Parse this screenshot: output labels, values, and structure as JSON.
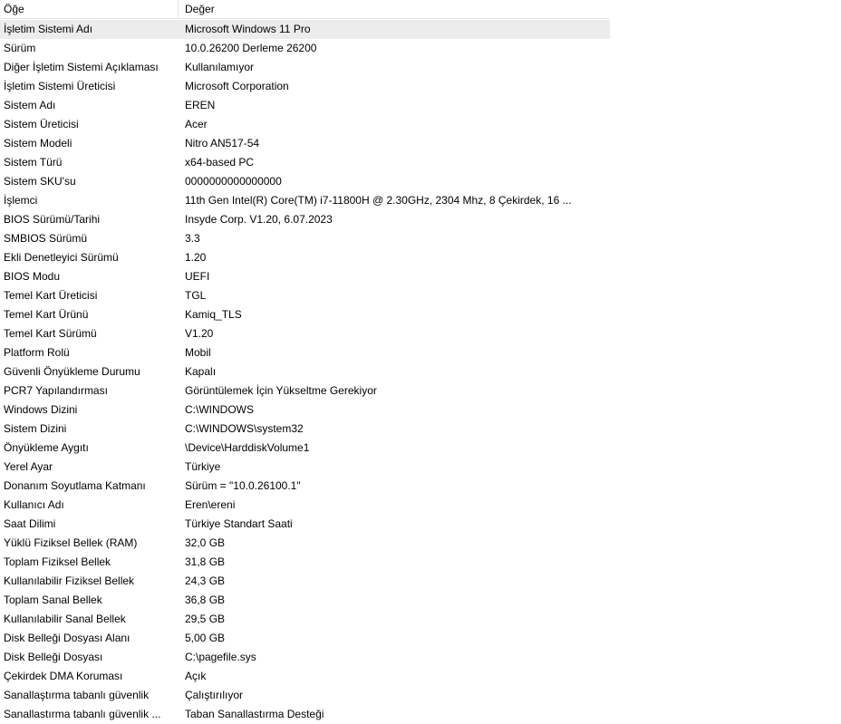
{
  "columns": {
    "item": "Öğe",
    "value": "Değer"
  },
  "rows": [
    {
      "item": "İşletim Sistemi Adı",
      "value": "Microsoft Windows 11 Pro"
    },
    {
      "item": "Sürüm",
      "value": "10.0.26200 Derleme 26200"
    },
    {
      "item": "Diğer İşletim Sistemi Açıklaması",
      "value": "Kullanılamıyor"
    },
    {
      "item": "İşletim Sistemi Üreticisi",
      "value": "Microsoft Corporation"
    },
    {
      "item": "Sistem Adı",
      "value": "EREN"
    },
    {
      "item": "Sistem Üreticisi",
      "value": "Acer"
    },
    {
      "item": "Sistem Modeli",
      "value": "Nitro AN517-54"
    },
    {
      "item": "Sistem Türü",
      "value": "x64-based PC"
    },
    {
      "item": "Sistem SKU'su",
      "value": "0000000000000000"
    },
    {
      "item": "İşlemci",
      "value": "11th Gen Intel(R) Core(TM) i7-11800H @ 2.30GHz, 2304 Mhz, 8 Çekirdek, 16 ..."
    },
    {
      "item": "BIOS Sürümü/Tarihi",
      "value": "Insyde Corp. V1.20, 6.07.2023"
    },
    {
      "item": "SMBIOS Sürümü",
      "value": "3.3"
    },
    {
      "item": "Ekli Denetleyici Sürümü",
      "value": "1.20"
    },
    {
      "item": "BIOS Modu",
      "value": "UEFI"
    },
    {
      "item": "Temel Kart Üreticisi",
      "value": "TGL"
    },
    {
      "item": "Temel Kart Ürünü",
      "value": "Kamiq_TLS"
    },
    {
      "item": "Temel Kart Sürümü",
      "value": "V1.20"
    },
    {
      "item": "Platform Rolü",
      "value": "Mobil"
    },
    {
      "item": "Güvenli Önyükleme Durumu",
      "value": "Kapalı"
    },
    {
      "item": "PCR7 Yapılandırması",
      "value": "Görüntülemek İçin Yükseltme Gerekiyor"
    },
    {
      "item": "Windows Dizini",
      "value": "C:\\WINDOWS"
    },
    {
      "item": "Sistem Dizini",
      "value": "C:\\WINDOWS\\system32"
    },
    {
      "item": "Önyükleme Aygıtı",
      "value": "\\Device\\HarddiskVolume1"
    },
    {
      "item": "Yerel Ayar",
      "value": "Türkiye"
    },
    {
      "item": "Donanım Soyutlama Katmanı",
      "value": "Sürüm = \"10.0.26100.1\""
    },
    {
      "item": "Kullanıcı Adı",
      "value": "Eren\\ereni"
    },
    {
      "item": "Saat Dilimi",
      "value": "Türkiye Standart Saati"
    },
    {
      "item": "Yüklü Fiziksel Bellek (RAM)",
      "value": "32,0 GB"
    },
    {
      "item": "Toplam Fiziksel Bellek",
      "value": "31,8 GB"
    },
    {
      "item": "Kullanılabilir Fiziksel Bellek",
      "value": "24,3 GB"
    },
    {
      "item": "Toplam Sanal Bellek",
      "value": "36,8 GB"
    },
    {
      "item": "Kullanılabilir Sanal Bellek",
      "value": "29,5 GB"
    },
    {
      "item": "Disk Belleği Dosyası Alanı",
      "value": "5,00 GB"
    },
    {
      "item": "Disk Belleği Dosyası",
      "value": "C:\\pagefile.sys"
    },
    {
      "item": "Çekirdek DMA Koruması",
      "value": "Açık"
    },
    {
      "item": "Sanallaştırma tabanlı güvenlik",
      "value": "Çalıştırılıyor"
    },
    {
      "item": "Sanallastırma tabanlı güvenlik ...",
      "value": "Taban Sanallastırma Desteği"
    }
  ],
  "selected_row": 0,
  "colors": {
    "selected_row_bg": "#ececec",
    "header_divider": "#e5e5e5"
  }
}
